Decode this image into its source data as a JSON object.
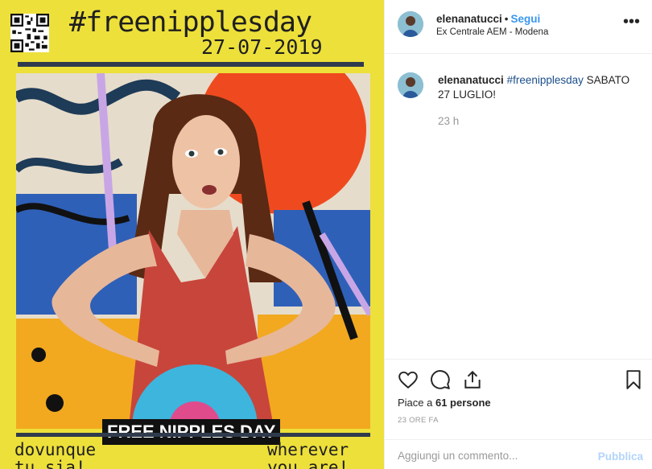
{
  "poster": {
    "hashtag": "#freenipplesday",
    "date": "27-07-2019",
    "banner": "FREE NIPPLES DAY",
    "slogan_left": "dovunque\ntu sia!",
    "slogan_right": "wherever\nyou are!"
  },
  "post": {
    "username": "elenanatucci",
    "follow_label": "Segui",
    "location": "Ex Centrale AEM - Modena",
    "more_icon": "more-options-icon",
    "caption": {
      "username": "elenanatucci",
      "hashtag": "#freenipplesday",
      "text": " SABATO 27 LUGLIO!",
      "time": "23 h"
    },
    "likes_prefix": "Piace a ",
    "likes_count": "61 persone",
    "time_ago": "23 ORE FA",
    "comment_placeholder": "Aggiungi un commento...",
    "publish_label": "Pubblica"
  },
  "icons": [
    "qr-code-icon",
    "heart-icon",
    "comment-icon",
    "share-icon",
    "bookmark-icon"
  ],
  "colors": {
    "poster_bg": "#ede03a",
    "link": "#3897f0",
    "hashtag": "#1b4e8a",
    "muted": "#999999",
    "publish_disabled": "#b3d4fb"
  }
}
